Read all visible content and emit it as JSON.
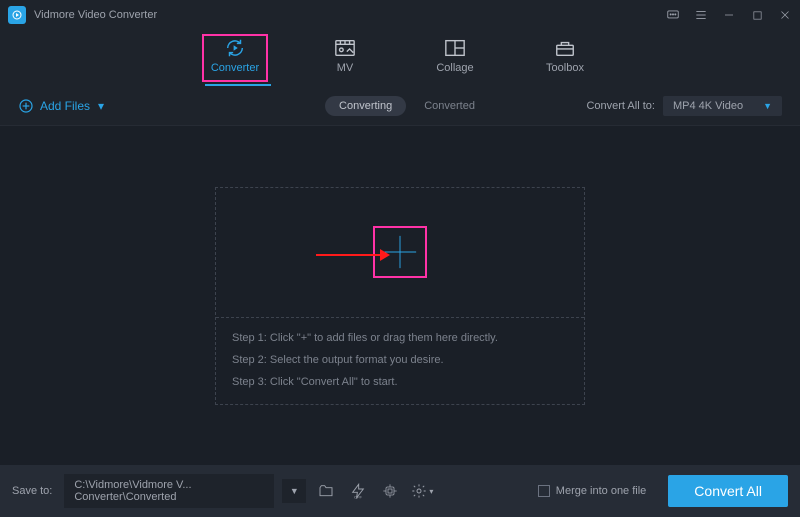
{
  "titlebar": {
    "app_name": "Vidmore Video Converter"
  },
  "tabs": {
    "converter": "Converter",
    "mv": "MV",
    "collage": "Collage",
    "toolbox": "Toolbox"
  },
  "secondary": {
    "add_files": "Add Files",
    "converting": "Converting",
    "converted": "Converted",
    "convert_all_to_label": "Convert All to:",
    "format_selected": "MP4 4K Video"
  },
  "dropzone": {
    "step1": "Step 1: Click \"+\" to add files or drag them here directly.",
    "step2": "Step 2: Select the output format you desire.",
    "step3": "Step 3: Click \"Convert All\" to start."
  },
  "bottom": {
    "save_to_label": "Save to:",
    "path": "C:\\Vidmore\\Vidmore V... Converter\\Converted",
    "merge_label": "Merge into one file",
    "convert_all_btn": "Convert All"
  }
}
